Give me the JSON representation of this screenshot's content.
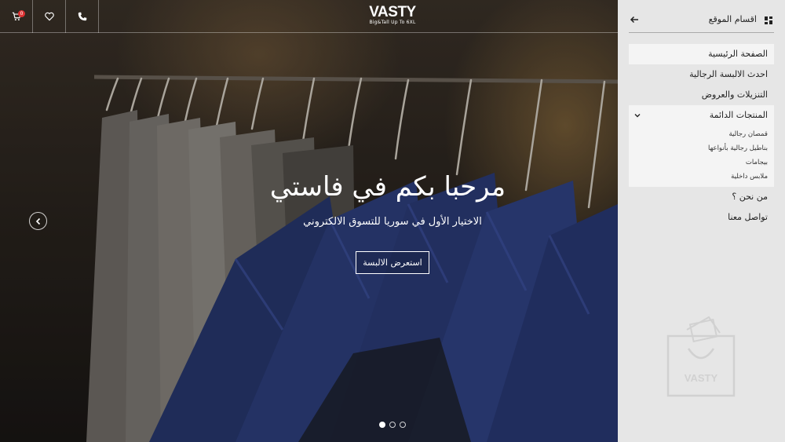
{
  "header": {
    "cart_count": "0",
    "logo_brand": "VASTY",
    "logo_tagline": "Big&Tall Up To 6XL"
  },
  "hero": {
    "title": "مرحبا بكم في فاستي",
    "subtitle": "الاختيار الأول في سوريا للتسوق الالكتروني",
    "cta_label": "استعرض الالبسة",
    "slides": 3,
    "active_slide": 1
  },
  "sidebar": {
    "title": "اقسام الموقع",
    "items": [
      {
        "label": "الصفحة الرئيسية"
      },
      {
        "label": "احدث الالبسة الرجالية"
      },
      {
        "label": "التنزيلات والعروض"
      },
      {
        "label": "المنتجات الدائمة"
      },
      {
        "label": "من نحن ؟"
      },
      {
        "label": "تواصل معنا"
      }
    ],
    "submenu": [
      {
        "label": "قمصان رجالية"
      },
      {
        "label": "بناطيل رجالية بأنواعها"
      },
      {
        "label": "بيجامات"
      },
      {
        "label": "ملابس داخلية"
      }
    ]
  },
  "colors": {
    "sidebar_bg": "#e6e6e6",
    "active_item_bg": "#f4f4f4",
    "badge": "#dd3333",
    "suit_blue": "#2b3a73"
  }
}
